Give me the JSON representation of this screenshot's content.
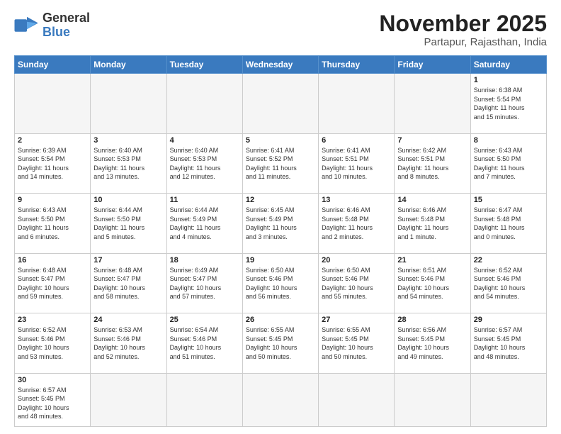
{
  "header": {
    "logo_general": "General",
    "logo_blue": "Blue",
    "month_title": "November 2025",
    "location": "Partapur, Rajasthan, India"
  },
  "weekdays": [
    "Sunday",
    "Monday",
    "Tuesday",
    "Wednesday",
    "Thursday",
    "Friday",
    "Saturday"
  ],
  "days": [
    {
      "num": "",
      "info": ""
    },
    {
      "num": "",
      "info": ""
    },
    {
      "num": "",
      "info": ""
    },
    {
      "num": "",
      "info": ""
    },
    {
      "num": "",
      "info": ""
    },
    {
      "num": "",
      "info": ""
    },
    {
      "num": "1",
      "info": "Sunrise: 6:38 AM\nSunset: 5:54 PM\nDaylight: 11 hours\nand 15 minutes."
    },
    {
      "num": "2",
      "info": "Sunrise: 6:39 AM\nSunset: 5:54 PM\nDaylight: 11 hours\nand 14 minutes."
    },
    {
      "num": "3",
      "info": "Sunrise: 6:40 AM\nSunset: 5:53 PM\nDaylight: 11 hours\nand 13 minutes."
    },
    {
      "num": "4",
      "info": "Sunrise: 6:40 AM\nSunset: 5:53 PM\nDaylight: 11 hours\nand 12 minutes."
    },
    {
      "num": "5",
      "info": "Sunrise: 6:41 AM\nSunset: 5:52 PM\nDaylight: 11 hours\nand 11 minutes."
    },
    {
      "num": "6",
      "info": "Sunrise: 6:41 AM\nSunset: 5:51 PM\nDaylight: 11 hours\nand 10 minutes."
    },
    {
      "num": "7",
      "info": "Sunrise: 6:42 AM\nSunset: 5:51 PM\nDaylight: 11 hours\nand 8 minutes."
    },
    {
      "num": "8",
      "info": "Sunrise: 6:43 AM\nSunset: 5:50 PM\nDaylight: 11 hours\nand 7 minutes."
    },
    {
      "num": "9",
      "info": "Sunrise: 6:43 AM\nSunset: 5:50 PM\nDaylight: 11 hours\nand 6 minutes."
    },
    {
      "num": "10",
      "info": "Sunrise: 6:44 AM\nSunset: 5:50 PM\nDaylight: 11 hours\nand 5 minutes."
    },
    {
      "num": "11",
      "info": "Sunrise: 6:44 AM\nSunset: 5:49 PM\nDaylight: 11 hours\nand 4 minutes."
    },
    {
      "num": "12",
      "info": "Sunrise: 6:45 AM\nSunset: 5:49 PM\nDaylight: 11 hours\nand 3 minutes."
    },
    {
      "num": "13",
      "info": "Sunrise: 6:46 AM\nSunset: 5:48 PM\nDaylight: 11 hours\nand 2 minutes."
    },
    {
      "num": "14",
      "info": "Sunrise: 6:46 AM\nSunset: 5:48 PM\nDaylight: 11 hours\nand 1 minute."
    },
    {
      "num": "15",
      "info": "Sunrise: 6:47 AM\nSunset: 5:48 PM\nDaylight: 11 hours\nand 0 minutes."
    },
    {
      "num": "16",
      "info": "Sunrise: 6:48 AM\nSunset: 5:47 PM\nDaylight: 10 hours\nand 59 minutes."
    },
    {
      "num": "17",
      "info": "Sunrise: 6:48 AM\nSunset: 5:47 PM\nDaylight: 10 hours\nand 58 minutes."
    },
    {
      "num": "18",
      "info": "Sunrise: 6:49 AM\nSunset: 5:47 PM\nDaylight: 10 hours\nand 57 minutes."
    },
    {
      "num": "19",
      "info": "Sunrise: 6:50 AM\nSunset: 5:46 PM\nDaylight: 10 hours\nand 56 minutes."
    },
    {
      "num": "20",
      "info": "Sunrise: 6:50 AM\nSunset: 5:46 PM\nDaylight: 10 hours\nand 55 minutes."
    },
    {
      "num": "21",
      "info": "Sunrise: 6:51 AM\nSunset: 5:46 PM\nDaylight: 10 hours\nand 54 minutes."
    },
    {
      "num": "22",
      "info": "Sunrise: 6:52 AM\nSunset: 5:46 PM\nDaylight: 10 hours\nand 54 minutes."
    },
    {
      "num": "23",
      "info": "Sunrise: 6:52 AM\nSunset: 5:46 PM\nDaylight: 10 hours\nand 53 minutes."
    },
    {
      "num": "24",
      "info": "Sunrise: 6:53 AM\nSunset: 5:46 PM\nDaylight: 10 hours\nand 52 minutes."
    },
    {
      "num": "25",
      "info": "Sunrise: 6:54 AM\nSunset: 5:46 PM\nDaylight: 10 hours\nand 51 minutes."
    },
    {
      "num": "26",
      "info": "Sunrise: 6:55 AM\nSunset: 5:45 PM\nDaylight: 10 hours\nand 50 minutes."
    },
    {
      "num": "27",
      "info": "Sunrise: 6:55 AM\nSunset: 5:45 PM\nDaylight: 10 hours\nand 50 minutes."
    },
    {
      "num": "28",
      "info": "Sunrise: 6:56 AM\nSunset: 5:45 PM\nDaylight: 10 hours\nand 49 minutes."
    },
    {
      "num": "29",
      "info": "Sunrise: 6:57 AM\nSunset: 5:45 PM\nDaylight: 10 hours\nand 48 minutes."
    },
    {
      "num": "30",
      "info": "Sunrise: 6:57 AM\nSunset: 5:45 PM\nDaylight: 10 hours\nand 48 minutes."
    },
    {
      "num": "",
      "info": ""
    },
    {
      "num": "",
      "info": ""
    },
    {
      "num": "",
      "info": ""
    },
    {
      "num": "",
      "info": ""
    },
    {
      "num": "",
      "info": ""
    },
    {
      "num": "",
      "info": ""
    }
  ]
}
